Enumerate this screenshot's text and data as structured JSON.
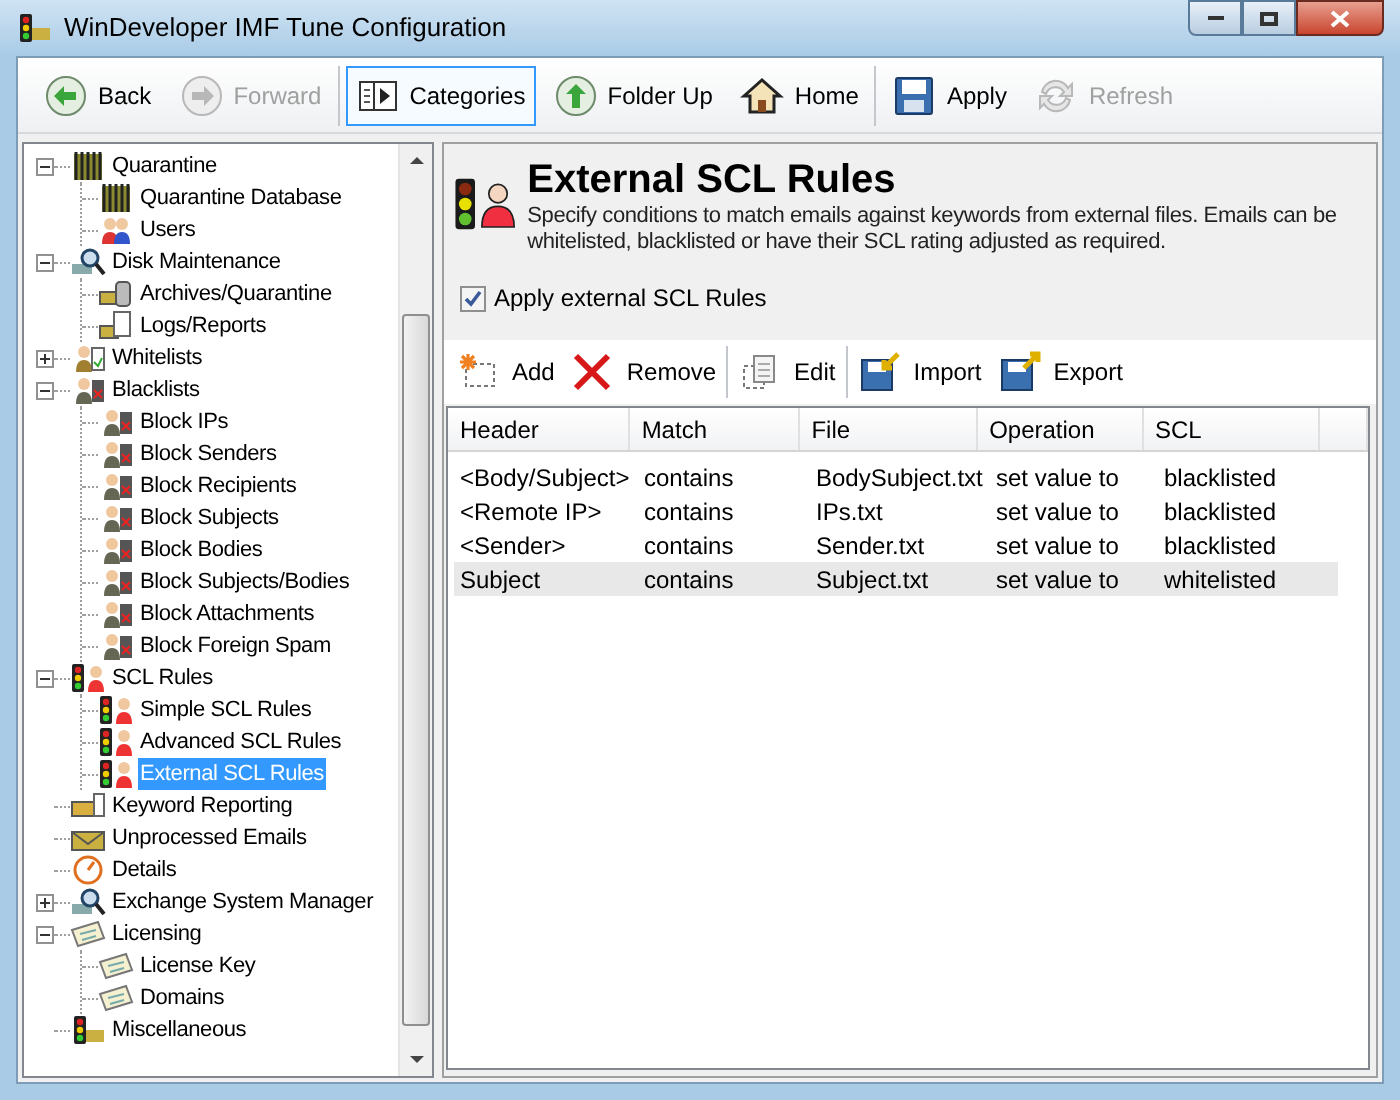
{
  "window": {
    "title": "WinDeveloper IMF Tune Configuration"
  },
  "toolbar": [
    [
      {
        "label": "Back",
        "kind": "back",
        "disabled": false,
        "selected": false
      },
      {
        "label": "Forward",
        "kind": "forward",
        "disabled": true,
        "selected": false
      }
    ],
    [
      {
        "label": "Categories",
        "kind": "categories",
        "disabled": false,
        "selected": true
      },
      {
        "label": "Folder Up",
        "kind": "up",
        "disabled": false,
        "selected": false
      },
      {
        "label": "Home",
        "kind": "home",
        "disabled": false,
        "selected": false
      }
    ],
    [
      {
        "label": "Apply",
        "kind": "disk",
        "disabled": false,
        "selected": false
      },
      {
        "label": "Refresh",
        "kind": "refresh",
        "disabled": true,
        "selected": false
      }
    ]
  ],
  "tree": [
    {
      "label": "Quarantine",
      "kind": "bars",
      "expanded": true,
      "selected": false,
      "children": [
        {
          "label": "Quarantine Database",
          "kind": "bars",
          "selected": false
        },
        {
          "label": "Users",
          "kind": "users",
          "selected": false
        }
      ]
    },
    {
      "label": "Disk Maintenance",
      "kind": "search",
      "expanded": true,
      "selected": false,
      "children": [
        {
          "label": "Archives/Quarantine",
          "kind": "archive",
          "selected": false
        },
        {
          "label": "Logs/Reports",
          "kind": "logs",
          "selected": false
        }
      ]
    },
    {
      "label": "Whitelists",
      "kind": "whitelist",
      "expanded": false,
      "selected": false
    },
    {
      "label": "Blacklists",
      "kind": "blacklist",
      "expanded": true,
      "selected": false,
      "children": [
        {
          "label": "Block IPs",
          "kind": "blacklist",
          "selected": false
        },
        {
          "label": "Block Senders",
          "kind": "blacklist",
          "selected": false
        },
        {
          "label": "Block Recipients",
          "kind": "blacklist",
          "selected": false
        },
        {
          "label": "Block Subjects",
          "kind": "blacklist",
          "selected": false
        },
        {
          "label": "Block Bodies",
          "kind": "blacklist",
          "selected": false
        },
        {
          "label": "Block Subjects/Bodies",
          "kind": "blacklist",
          "selected": false
        },
        {
          "label": "Block Attachments",
          "kind": "blacklist",
          "selected": false
        },
        {
          "label": "Block Foreign Spam",
          "kind": "blacklist",
          "selected": false
        }
      ]
    },
    {
      "label": "SCL Rules",
      "kind": "scl",
      "expanded": true,
      "selected": false,
      "children": [
        {
          "label": "Simple SCL Rules",
          "kind": "scl",
          "selected": false
        },
        {
          "label": "Advanced SCL Rules",
          "kind": "scl",
          "selected": false
        },
        {
          "label": "External SCL Rules",
          "kind": "scl",
          "selected": true
        }
      ]
    },
    {
      "label": "Keyword Reporting",
      "kind": "keyword",
      "selected": false
    },
    {
      "label": "Unprocessed Emails",
      "kind": "mail",
      "selected": false
    },
    {
      "label": "Details",
      "kind": "details",
      "selected": false
    },
    {
      "label": "Exchange System Manager",
      "kind": "search",
      "expanded": false,
      "selected": false
    },
    {
      "label": "Licensing",
      "kind": "license",
      "expanded": true,
      "selected": false,
      "children": [
        {
          "label": "License Key",
          "kind": "license",
          "selected": false
        },
        {
          "label": "Domains",
          "kind": "license",
          "selected": false
        }
      ]
    },
    {
      "label": "Miscellaneous",
      "kind": "misc",
      "selected": false
    }
  ],
  "page": {
    "title": "External SCL Rules",
    "description": "Specify conditions to match emails against keywords from external files. Emails can be whitelisted, blacklisted or have their SCL rating adjusted as required.",
    "apply_checkbox": {
      "label": "Apply external SCL Rules",
      "checked": true
    }
  },
  "list_toolbar": [
    [
      {
        "label": "Add",
        "kind": "add"
      },
      {
        "label": "Remove",
        "kind": "remove"
      }
    ],
    [
      {
        "label": "Edit",
        "kind": "edit"
      }
    ],
    [
      {
        "label": "Import",
        "kind": "import"
      },
      {
        "label": "Export",
        "kind": "export"
      }
    ]
  ],
  "table": {
    "columns": [
      "Header",
      "Match",
      "File",
      "Operation",
      "SCL"
    ],
    "rows": [
      {
        "cells": [
          "<Body/Subject>",
          "contains",
          "BodySubject.txt",
          "set value to",
          "blacklisted"
        ],
        "selected": false
      },
      {
        "cells": [
          "<Remote IP>",
          "contains",
          "IPs.txt",
          "set value to",
          "blacklisted"
        ],
        "selected": false
      },
      {
        "cells": [
          "<Sender>",
          "contains",
          "Sender.txt",
          "set value to",
          "blacklisted"
        ],
        "selected": false
      },
      {
        "cells": [
          "Subject",
          "contains",
          "Subject.txt",
          "set value to",
          "whitelisted"
        ],
        "selected": true
      }
    ]
  }
}
